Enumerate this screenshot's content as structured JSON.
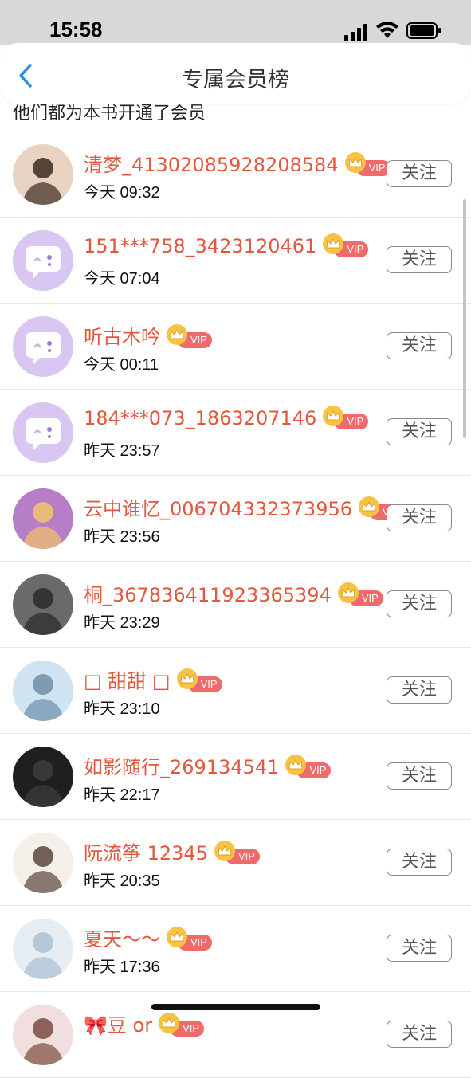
{
  "status_bar": {
    "time": "15:58"
  },
  "nav": {
    "title": "专属会员榜"
  },
  "subtitle": "他们都为本书开通了会员",
  "vip_label": "VIP",
  "follow_label": "关注",
  "colors": {
    "username": "#e2583e",
    "vip_tag": "#ef6a6a",
    "crown": "#f6c344",
    "placeholder_avatar": "#d9c6f3"
  },
  "members": [
    {
      "name": "清梦_41302085928208584",
      "time": "今天 09:32",
      "avatar": "photo-avatar"
    },
    {
      "name": "151***758_3423120461",
      "time": "今天 07:04",
      "avatar": "default-chat-avatar"
    },
    {
      "name": "听古木吟",
      "time": "今天 00:11",
      "avatar": "default-chat-avatar"
    },
    {
      "name": "184***073_1863207146",
      "time": "昨天 23:57",
      "avatar": "default-chat-avatar"
    },
    {
      "name": "云中谁忆_006704332373956",
      "time": "昨天 23:56",
      "avatar": "anime-avatar"
    },
    {
      "name": "桐_367836411923365394",
      "time": "昨天 23:29",
      "avatar": "photo-avatar"
    },
    {
      "name": "□ 甜甜 □",
      "time": "昨天 23:10",
      "avatar": "photo-avatar"
    },
    {
      "name": "如影随行_269134541",
      "time": "昨天 22:17",
      "avatar": "photo-avatar"
    },
    {
      "name": "阮流筝 12345",
      "time": "昨天 20:35",
      "avatar": "anime-avatar"
    },
    {
      "name": "夏天～～",
      "time": "昨天 17:36",
      "avatar": "anime-avatar"
    },
    {
      "name": "🎀豆 or",
      "time": "",
      "avatar": "anime-avatar"
    }
  ]
}
